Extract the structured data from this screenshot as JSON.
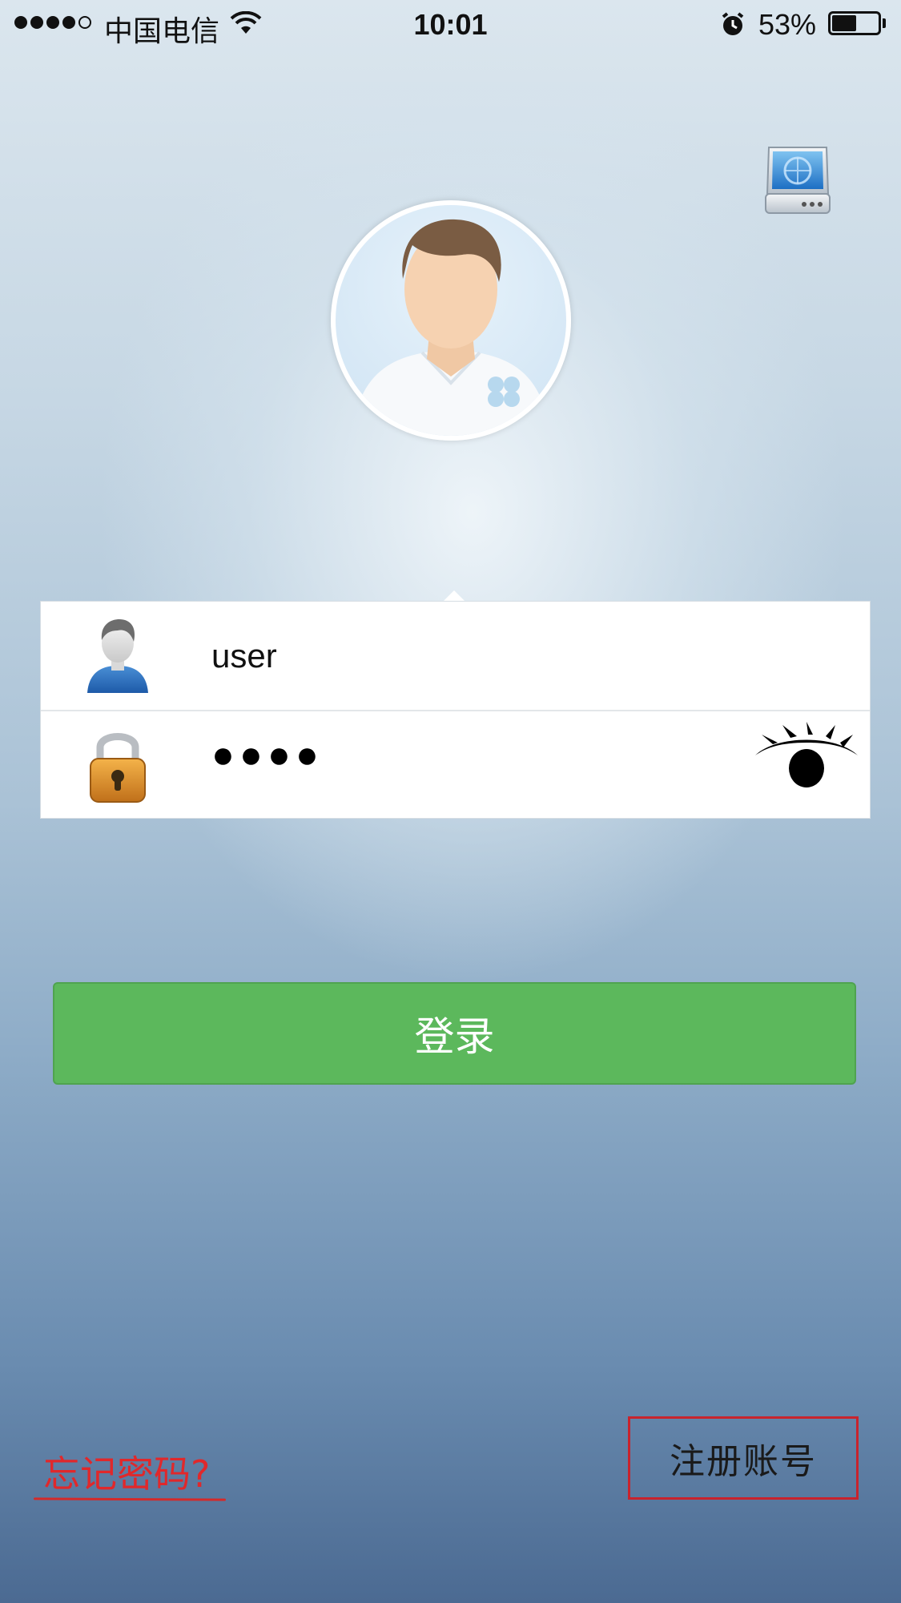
{
  "status_bar": {
    "carrier": "中国电信",
    "time": "10:01",
    "battery_percent": "53%",
    "battery_level": 0.53,
    "signal_bars_filled": 4,
    "signal_bars_total": 5
  },
  "login": {
    "username_value": "user",
    "password_masked": "●●●●"
  },
  "buttons": {
    "login_label": "登录"
  },
  "links": {
    "forgot_password": "忘记密码?",
    "register": "注册账号"
  },
  "icons": {
    "server": "server-settings-icon",
    "avatar": "default-avatar",
    "user": "user-icon",
    "lock": "lock-icon",
    "eye": "eye-show-password-icon"
  },
  "colors": {
    "login_button": "#5cb85c",
    "forgot_link": "#e0282b",
    "register_border": "#c8232d"
  }
}
